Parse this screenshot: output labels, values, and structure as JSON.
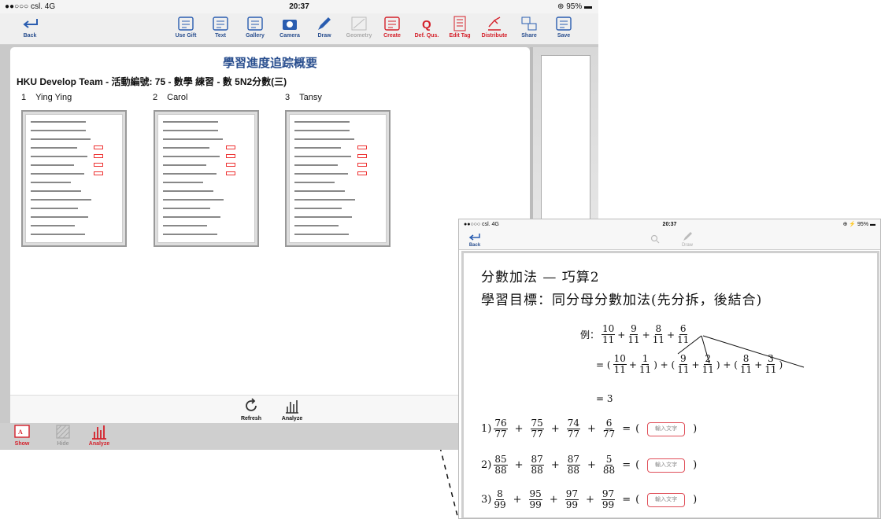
{
  "status": {
    "carrier": "●●○○○ csl.  4G",
    "time": "20:37",
    "battery": "⊕ 95% ▬"
  },
  "toolbar": {
    "back": "Back",
    "items": [
      {
        "label": "Use Gift",
        "color": "blue"
      },
      {
        "label": "Text",
        "color": "blue"
      },
      {
        "label": "Gallery",
        "color": "blue"
      },
      {
        "label": "Camera",
        "color": "blue"
      },
      {
        "label": "Draw",
        "color": "blue"
      },
      {
        "label": "Geometry",
        "color": "gray"
      },
      {
        "label": "Create",
        "color": "red"
      },
      {
        "label": "Def. Qus.",
        "color": "red"
      },
      {
        "label": "Edit Tag",
        "color": "red"
      },
      {
        "label": "Distribute",
        "color": "red"
      },
      {
        "label": "Share",
        "color": "blue"
      },
      {
        "label": "Save",
        "color": "blue"
      }
    ]
  },
  "main": {
    "title": "學習進度追踪概要",
    "subtitle": "HKU Develop Team - 活動編號: 75 - 數學 練習 - 數 5N2分數(三)",
    "students": [
      {
        "num": "1",
        "name": "Ying Ying"
      },
      {
        "num": "2",
        "name": "Carol"
      },
      {
        "num": "3",
        "name": "Tansy"
      }
    ]
  },
  "bottom": {
    "refresh": "Refresh",
    "analyze": "Analyze"
  },
  "tabs": {
    "show": "Show",
    "hide": "Hide",
    "analyze": "Analyze"
  },
  "zoom": {
    "status": {
      "carrier": "●●○○○ csl.  4G",
      "time": "20:37",
      "battery": "⊕ ⚡ 95% ▬"
    },
    "back": "Back",
    "draw": "Draw",
    "heading1": "分數加法 — 巧算2",
    "heading2": "學習目標：同分母分數加法(先分拆，後結合)",
    "example_label": "例：",
    "example_result": "=     3",
    "input_placeholder": "輸入文字",
    "questions": [
      {
        "n": "1)",
        "terms": [
          [
            "76",
            "77"
          ],
          [
            "75",
            "77"
          ],
          [
            "74",
            "77"
          ],
          [
            "6",
            "77"
          ]
        ]
      },
      {
        "n": "2)",
        "terms": [
          [
            "85",
            "88"
          ],
          [
            "87",
            "88"
          ],
          [
            "87",
            "88"
          ],
          [
            "5",
            "88"
          ]
        ]
      },
      {
        "n": "3)",
        "terms": [
          [
            "8",
            "99"
          ],
          [
            "95",
            "99"
          ],
          [
            "97",
            "99"
          ],
          [
            "97",
            "99"
          ]
        ]
      }
    ]
  }
}
